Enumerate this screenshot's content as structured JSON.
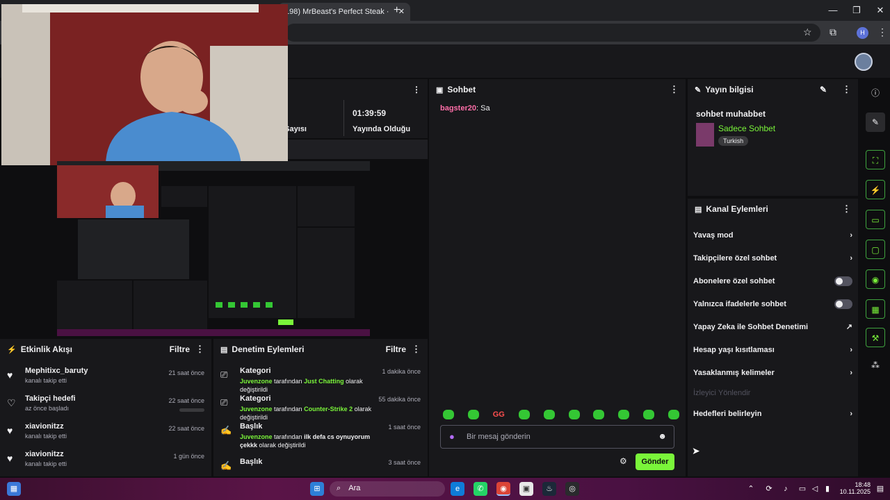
{
  "browser": {
    "tab_title": "198) MrBeast's Perfect Steak ·",
    "close": "✕",
    "new_tab": "+",
    "minimize": "—",
    "maximize": "❐",
    "close_window": "✕",
    "profile_initial": "H"
  },
  "stats": {
    "uptime": "01:39:59",
    "uptime_label": "Yayında Olduğu",
    "partial_label": "e Sayısı"
  },
  "chat": {
    "title": "Sohbet",
    "user": "bagster20",
    "message": "Sa",
    "input_placeholder": "Bir mesaj gönderin",
    "send_label": "Gönder",
    "emote_text": "GG"
  },
  "info": {
    "title": "Yayın bilgisi",
    "stream_title": "sohbet muhabbet",
    "category": "Sadece Sohbet",
    "tag": "Turkish"
  },
  "actions": {
    "title": "Kanal Eylemleri",
    "items": [
      {
        "label": "Yavaş mod",
        "type": "arrow"
      },
      {
        "label": "Takipçilere özel sohbet",
        "type": "arrow"
      },
      {
        "label": "Abonelere özel sohbet",
        "type": "toggle"
      },
      {
        "label": "Yalnızca ifadelerle sohbet",
        "type": "toggle"
      },
      {
        "label": "Yapay Zeka ile Sohbet Denetimi",
        "type": "external"
      },
      {
        "label": "Hesap yaşı kısıtlaması",
        "type": "arrow"
      },
      {
        "label": "Yasaklanmış kelimeler",
        "type": "arrow"
      },
      {
        "label": "İzleyici Yönlendir",
        "type": "disabled"
      },
      {
        "label": "Hedefleri belirleyin",
        "type": "arrow"
      }
    ]
  },
  "activity": {
    "title": "Etkinlik Akışı",
    "filter": "Filtre",
    "items": [
      {
        "name": "Mephitixc_baruty",
        "sub": "kanalı takip etti",
        "time": "21 saat önce",
        "filled": true
      },
      {
        "name": "Takipçi hedefi",
        "sub": "az önce başladı",
        "time": "22 saat önce",
        "filled": false
      },
      {
        "name": "xiavionitzz",
        "sub": "kanalı takip etti",
        "time": "22 saat önce",
        "filled": true
      },
      {
        "name": "xiavionitzz",
        "sub": "kanalı takip etti",
        "time": "1 gün önce",
        "filled": true
      }
    ]
  },
  "mod": {
    "title": "Denetim Eylemleri",
    "filter": "Filtre",
    "items": [
      {
        "title": "Kategori",
        "time": "1 dakika önce",
        "user": "Juvenzone",
        "mid": "tarafından",
        "value": "Just Chatting",
        "end": "olarak değiştirildi"
      },
      {
        "title": "Kategori",
        "time": "55 dakika önce",
        "user": "Juvenzone",
        "mid": "tarafından",
        "value": "Counter-Strike 2",
        "end": "olarak değiştirildi"
      },
      {
        "title": "Başlık",
        "time": "1 saat önce",
        "user": "Juvenzone",
        "mid": "tarafından",
        "value": "ilk defa cs oynuyorum çekkk",
        "end": "olarak değiştirildi"
      },
      {
        "title": "Başlık",
        "time": "3 saat önce",
        "user": "",
        "mid": "",
        "value": "",
        "end": ""
      }
    ]
  },
  "taskbar": {
    "search": "Ara",
    "time": "18:48",
    "date": "10.11.2025"
  },
  "colors": {
    "accent": "#7af53a",
    "bg": "#0e0e10",
    "panel": "#18181b",
    "username": "#ff6ea8"
  }
}
